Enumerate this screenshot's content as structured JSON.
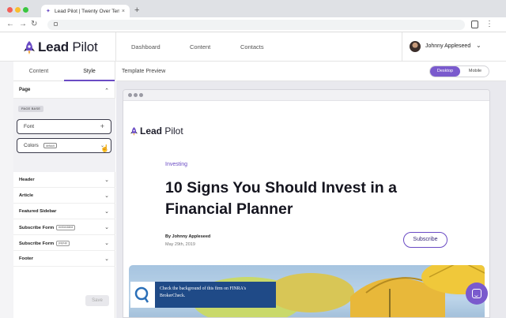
{
  "browser": {
    "tab_title": "Lead Pilot | Twenty Over Ten",
    "tab_close": "×",
    "new_tab": "+",
    "nav": {
      "back": "←",
      "forward": "→",
      "reload": "↻"
    },
    "menu_glyph": "⋮"
  },
  "app": {
    "logo": {
      "bold": "Lead",
      "rest": " Pilot"
    },
    "nav": [
      "Dashboard",
      "Content",
      "Contacts"
    ],
    "user": {
      "name": "Johnny Appleseed",
      "chevron": "⌄"
    }
  },
  "sidebar": {
    "tabs": [
      {
        "label": "Content",
        "active": false
      },
      {
        "label": "Style",
        "active": true
      }
    ],
    "page_section": {
      "label": "Page",
      "chevron": "⌃"
    },
    "page_base_tag": "PAGE BASE",
    "font": {
      "label": "Font",
      "action": "+"
    },
    "colors": {
      "label": "Colors",
      "badge": "default",
      "chevron": "⌄"
    },
    "sections": [
      {
        "label": "Header",
        "tag": ""
      },
      {
        "label": "Article",
        "tag": ""
      },
      {
        "label": "Featured Sidebar",
        "tag": ""
      },
      {
        "label": "Subscribe Form",
        "tag": "embedded"
      },
      {
        "label": "Subscribe Form",
        "tag": "popup"
      },
      {
        "label": "Footer",
        "tag": ""
      }
    ],
    "section_chevron": "⌄",
    "save_label": "Save"
  },
  "preview": {
    "title": "Template Preview",
    "toggle": {
      "desktop": "Desktop",
      "mobile": "Mobile",
      "selected": "Desktop"
    }
  },
  "article": {
    "logo": {
      "bold": "Lead",
      "rest": " Pilot"
    },
    "category": "Investing",
    "headline": "10 Signs You Should Invest in a Financial Planner",
    "author": "By Johnny Appleseed",
    "date": "May 29th, 2019",
    "subscribe_label": "Subscribe",
    "notice": "Check the background of this firm on FINRA's BrokerCheck."
  },
  "colors": {
    "accent": "#7a5acd",
    "notice_bg": "#1f4a87",
    "umbrella_yellow": "#e8c43a"
  }
}
